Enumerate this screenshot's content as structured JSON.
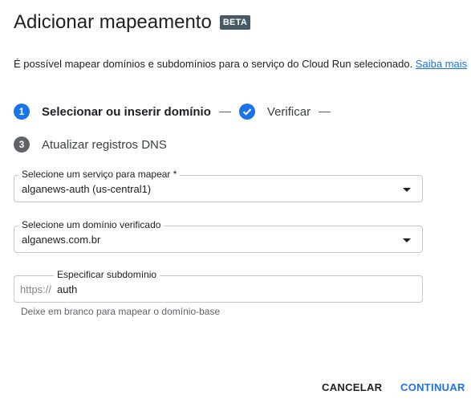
{
  "dialog": {
    "title": "Adicionar mapeamento",
    "badge": "BETA",
    "description": "É possível mapear domínios e subdomínios para o serviço do Cloud Run selecionado.",
    "learn_more": "Saiba mais"
  },
  "stepper": {
    "steps": [
      {
        "number": "1",
        "label": "Selecionar ou inserir domínio",
        "state": "active"
      },
      {
        "number": "",
        "label": "Verificar",
        "state": "completed",
        "icon": "check-icon"
      },
      {
        "number": "3",
        "label": "Atualizar registros DNS",
        "state": "pending"
      }
    ]
  },
  "fields": {
    "service": {
      "label": "Selecione um serviço para mapear *",
      "value": "alganews-auth (us-central1)"
    },
    "domain": {
      "label": "Selecione um domínio verificado",
      "value": "alganews.com.br"
    },
    "subdomain": {
      "label": "Especificar subdomínio",
      "prefix": "https://",
      "value": "auth",
      "helper": "Deixe em branco para mapear o domínio-base"
    }
  },
  "actions": {
    "cancel": "CANCELAR",
    "continue": "CONTINUAR"
  },
  "colors": {
    "accent": "#1a73e8",
    "badge_bg": "#455a64",
    "step_inactive": "#5f6368"
  }
}
